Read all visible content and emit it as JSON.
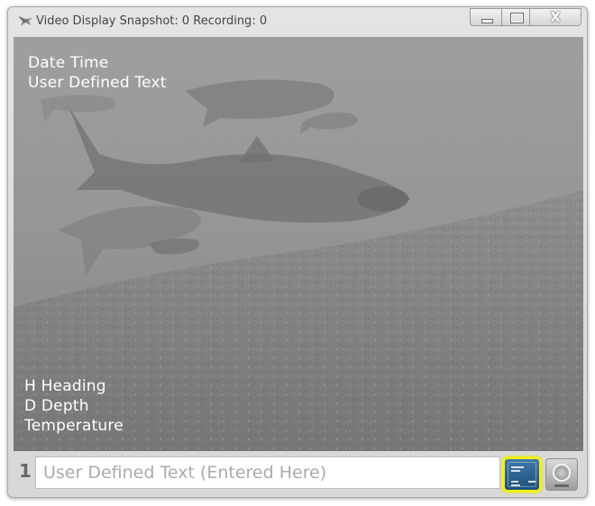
{
  "window": {
    "title": "Video Display Snapshot: 0 Recording: 0",
    "close_glyph": "X",
    "app_icon": "fish-icon"
  },
  "overlay": {
    "top_lines": [
      "Date Time",
      "User Defined Text"
    ],
    "bottom_lines": [
      "H Heading",
      "D Depth",
      "Temperature"
    ]
  },
  "bottom_bar": {
    "channel_number": "1",
    "text_input_placeholder": "User Defined Text (Entered Here)",
    "overlay_button_icon": "text-overlay-icon",
    "snapshot_button_icon": "camera-icon",
    "highlight_color": "#f0f018"
  },
  "colors": {
    "window_frame": "#dcdcdc",
    "video_tint": "#8c8c8c"
  }
}
